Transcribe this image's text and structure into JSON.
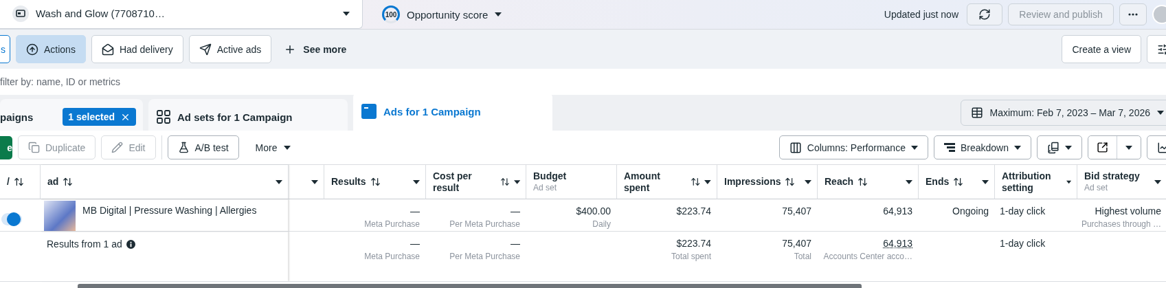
{
  "top_bar": {
    "account": "Wash and Glow (7708710…",
    "score": "100",
    "score_label": "Opportunity score",
    "updated": "Updated just now",
    "review": {
      "label": "Review and publish",
      "disabled": true
    }
  },
  "filters": {
    "chips": [
      {
        "label": "s",
        "selected": false,
        "outlined": true
      },
      {
        "label": "Actions",
        "selected": true,
        "outlined": false
      },
      {
        "label": "Had delivery",
        "selected": false,
        "outlined": false
      },
      {
        "label": "Active ads",
        "selected": false,
        "outlined": false
      }
    ],
    "see_more": "See more",
    "create_view": "Create a view"
  },
  "search": {
    "placeholder": "filter by: name, ID or metrics"
  },
  "tabs": [
    {
      "label": "paigns",
      "selected": false,
      "badge": "1 selected"
    },
    {
      "label": "Ad sets for 1 Campaign",
      "selected": false
    },
    {
      "label": "Ads for 1 Campaign",
      "selected": true
    }
  ],
  "date_range": "Maximum: Feb 7, 2023 – Mar 7, 2026",
  "toolbar": {
    "create": "e",
    "actions": [
      {
        "label": "Duplicate",
        "disabled": true
      },
      {
        "label": "Edit",
        "disabled": true
      },
      {
        "label": "A/B test",
        "disabled": false
      }
    ],
    "more": "More",
    "columns": "Columns: Performance",
    "breakdown": "Breakdown"
  },
  "table": {
    "columns": [
      {
        "kind": "toggle",
        "label": "/",
        "sortable": true,
        "menu": false
      },
      {
        "kind": "name",
        "label": "ad",
        "sortable": true,
        "menu": true
      },
      {
        "kind": "blank",
        "sortable": false,
        "menu": true
      },
      {
        "kind": "number",
        "label": "Results",
        "sortable": true,
        "menu": true
      },
      {
        "kind": "number",
        "label": "Cost per result",
        "sortable": true,
        "menu": true
      },
      {
        "kind": "number",
        "label": "Budget",
        "sub": "Ad set",
        "sortable": false,
        "menu": false
      },
      {
        "kind": "number",
        "label": "Amount spent",
        "sortable": true,
        "menu": true
      },
      {
        "kind": "number",
        "label": "Impressions",
        "sortable": true,
        "menu": true
      },
      {
        "kind": "number",
        "label": "Reach",
        "sortable": true,
        "menu": true
      },
      {
        "kind": "number",
        "label": "Ends",
        "sortable": true,
        "menu": true
      },
      {
        "kind": "text",
        "label": "Attribution setting",
        "sortable": false,
        "menu": true
      },
      {
        "kind": "number",
        "label": "Bid strategy",
        "sub": "Ad set",
        "sortable": false,
        "menu": true
      }
    ],
    "rows": [
      {
        "on": true,
        "cells": [
          {},
          {
            "value": "MB Digital | Pressure Washing | Allergies"
          },
          {},
          {
            "value": "—",
            "sub": "Meta Purchase"
          },
          {
            "value": "—",
            "sub": "Per Meta Purchase"
          },
          {
            "value": "$400.00",
            "sub": "Daily"
          },
          {
            "value": "$223.74"
          },
          {
            "value": "75,407"
          },
          {
            "value": "64,913"
          },
          {
            "value": "Ongoing"
          },
          {
            "value": "1-day click"
          },
          {
            "value": "Highest volume",
            "sub": "Purchases through …"
          }
        ]
      }
    ],
    "summary": {
      "cells": [
        {},
        {
          "value": "Results from 1 ad"
        },
        {},
        {
          "value": "—",
          "sub": "Meta Purchase"
        },
        {
          "value": "—",
          "sub": "Per Meta Purchase"
        },
        {},
        {
          "value": "$223.74",
          "sub": "Total spent"
        },
        {
          "value": "75,407",
          "sub": "Total"
        },
        {
          "value": "64,913",
          "sub": "Accounts Center acco…",
          "underline": true
        },
        {},
        {
          "value": "1-day click"
        },
        {}
      ]
    }
  }
}
